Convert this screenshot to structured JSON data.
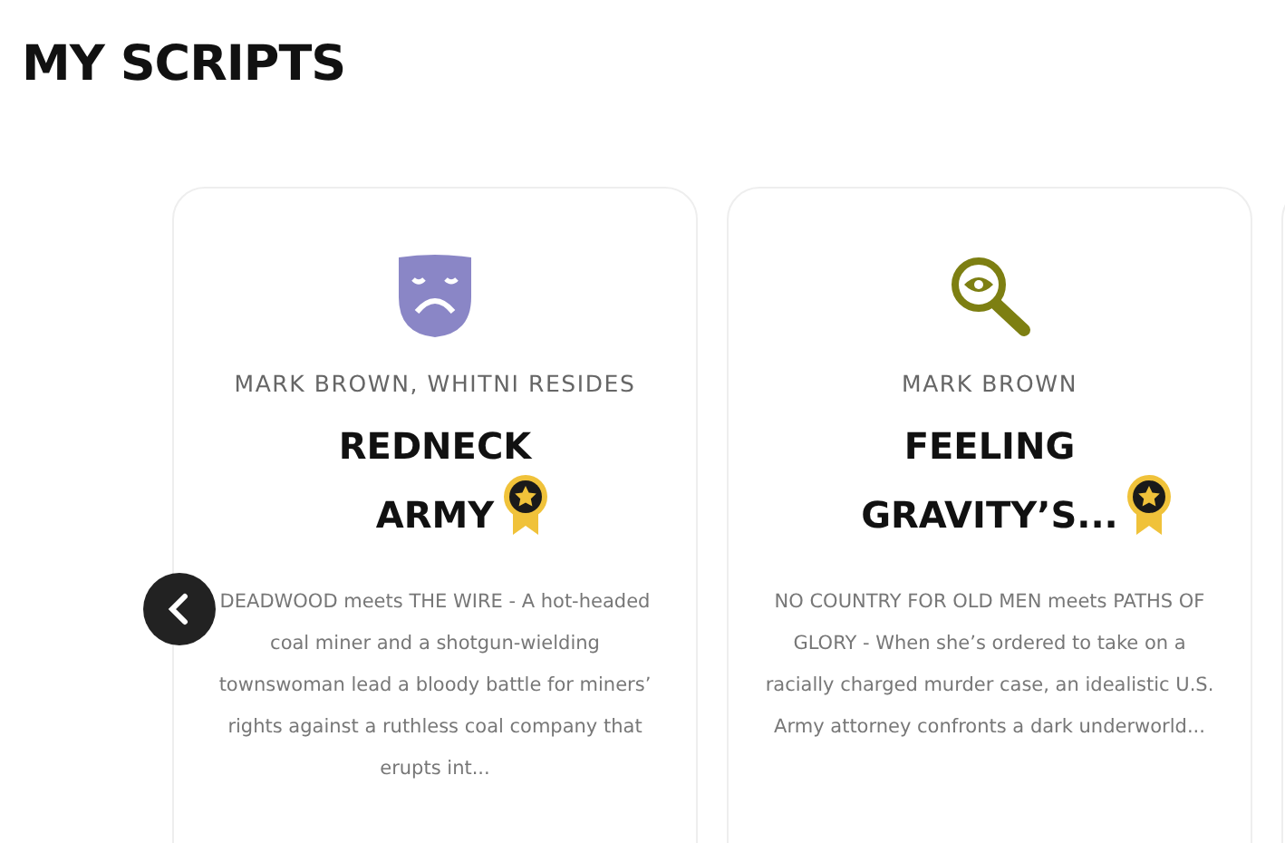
{
  "heading": "MY SCRIPTS",
  "carousel": {
    "back_button": true
  },
  "scripts": [
    {
      "kind": "mask",
      "authors": "MARK BROWN, WHITNI RESIDES",
      "title": "REDNECK ARMY",
      "awarded": true,
      "description": "DEADWOOD meets THE WIRE - A hot-headed coal miner and a shotgun-wielding townswoman lead a bloody battle for miners’ rights against a ruthless coal company that erupts int..."
    },
    {
      "kind": "magnifier",
      "authors": "MARK BROWN",
      "title": "FEELING GRAVITY’S...",
      "awarded": true,
      "description": "NO COUNTRY FOR OLD MEN meets PATHS OF GLORY - When she’s ordered to take on a racially charged murder case, an idealistic U.S. Army attorney confronts a dark underworld..."
    }
  ]
}
